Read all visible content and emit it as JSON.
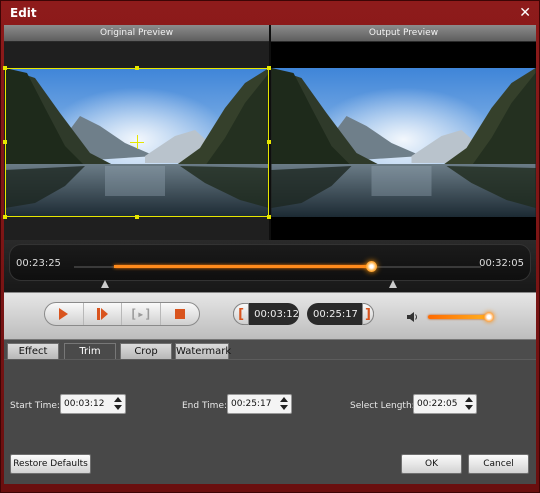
{
  "window": {
    "title": "Edit",
    "close_glyph": "✕"
  },
  "preview": {
    "original_label": "Original Preview",
    "output_label": "Output Preview"
  },
  "timeline": {
    "current_time": "00:23:25",
    "total_time": "00:32:05",
    "playhead_fraction": 0.73,
    "trim_start_fraction": 0.094,
    "trim_end_fraction": 0.78
  },
  "controls": {
    "play_icon": "play-icon",
    "next_frame_icon": "next-frame-icon",
    "mark_icon": "bracket-frame-icon",
    "stop_icon": "stop-icon",
    "set_start_glyph": "[",
    "start_time": "00:03:12",
    "end_time": "00:25:17",
    "set_end_glyph": "]",
    "volume_fraction": 0.93
  },
  "tabs": [
    {
      "label": "Effect",
      "active": false
    },
    {
      "label": "Trim",
      "active": true
    },
    {
      "label": "Crop",
      "active": false
    },
    {
      "label": "Watermark",
      "active": false
    }
  ],
  "trim": {
    "start_label": "Start Time:",
    "start_value": "00:03:12",
    "end_label": "End Time:",
    "end_value": "00:25:17",
    "length_label": "Select Length:",
    "length_value": "00:22:05"
  },
  "buttons": {
    "restore": "Restore Defaults",
    "ok": "OK",
    "cancel": "Cancel"
  },
  "colors": {
    "accent": "#ff8a1c",
    "frame_title": "#8e1b1b",
    "crop_frame": "#e6e600"
  }
}
